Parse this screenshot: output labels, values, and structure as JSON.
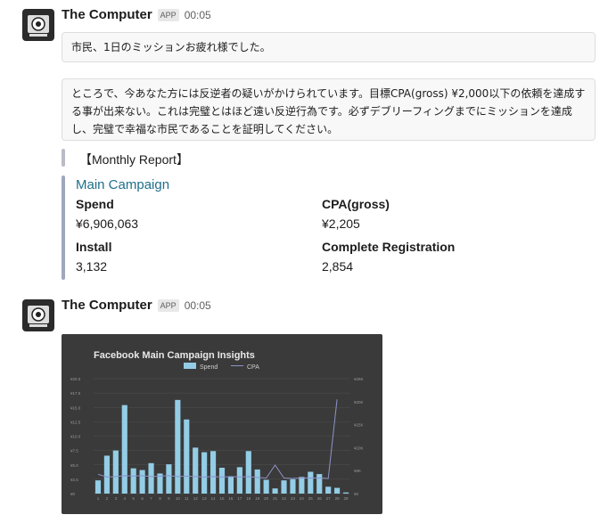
{
  "messages": [
    {
      "sender": "The Computer",
      "badge": "APP",
      "time": "00:05",
      "greeting": "市民、1日のミッションお疲れ様でした。",
      "body": "ところで、今あなた方には反逆者の疑いがかけられています。目標CPA(gross) ¥2,000以下の依頼を達成する事が出来ない。これは完璧とはほど遠い反逆行為です。必ずデブリーフィングまでにミッションを達成し、完璧で幸福な市民であることを証明してください。",
      "report_title": "【Monthly Report】",
      "attachment": {
        "title": "Main Campaign",
        "fields": [
          {
            "label": "Spend",
            "value": "¥6,906,063"
          },
          {
            "label": "CPA(gross)",
            "value": "¥2,205"
          },
          {
            "label": "Install",
            "value": "3,132"
          },
          {
            "label": "Complete Registration",
            "value": "2,854"
          }
        ]
      }
    },
    {
      "sender": "The Computer",
      "badge": "APP",
      "time": "00:05"
    }
  ],
  "colors": {
    "bar": "#93cde6",
    "cpa_line": "#8e94c9",
    "chart_bg": "#3a3a3a",
    "link": "#1f6f8b"
  },
  "icons": {
    "avatar": "computer-eye-icon"
  },
  "chart_data": {
    "type": "bar",
    "title": "Facebook Main Campaign Insights",
    "legend_position": "top",
    "grid": true,
    "categories": [
      "1",
      "2",
      "3",
      "4",
      "5",
      "6",
      "7",
      "8",
      "9",
      "10",
      "11",
      "12",
      "13",
      "14",
      "15",
      "16",
      "17",
      "18",
      "19",
      "20",
      "21",
      "22",
      "23",
      "24",
      "25",
      "26",
      "27",
      "28",
      "29"
    ],
    "y_ticks_left": [
      "¥0",
      "¥2.5",
      "¥5.0",
      "¥7.5",
      "¥10.0",
      "¥12.5",
      "¥15.0",
      "¥17.5",
      "¥20.0"
    ],
    "y_ticks_right": [
      "¥0",
      "¥5K",
      "¥10K",
      "¥15K",
      "¥20K",
      "¥25K"
    ],
    "ylim": [
      0,
      20
    ],
    "y2lim": [
      0,
      25000
    ],
    "series": [
      {
        "name": "Spend",
        "kind": "bar",
        "values": [
          2.3,
          6.6,
          7.5,
          15.4,
          4.4,
          4.1,
          5.3,
          3.5,
          5.1,
          16.3,
          12.9,
          8.0,
          7.2,
          7.4,
          4.5,
          3.0,
          4.6,
          7.4,
          4.2,
          2.4,
          0.9,
          2.3,
          2.5,
          2.9,
          3.8,
          3.4,
          1.2,
          1.0,
          0.2
        ]
      },
      {
        "name": "CPA",
        "kind": "line",
        "values": [
          4200,
          3600,
          3700,
          3900,
          3800,
          3900,
          3700,
          3800,
          3900,
          3700,
          3800,
          3700,
          3600,
          3700,
          3600,
          3700,
          3600,
          3700,
          3500,
          3400,
          6200,
          3400,
          3300,
          3400,
          3400,
          3400,
          3300,
          20500,
          null
        ]
      }
    ]
  }
}
